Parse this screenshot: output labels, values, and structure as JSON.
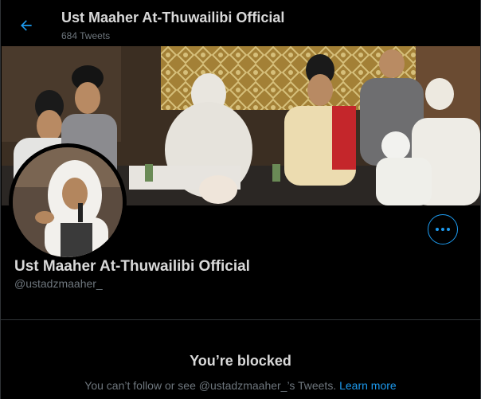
{
  "header": {
    "title": "Ust Maaher At-Thuwailibi Official",
    "tweet_count": "684 Tweets"
  },
  "profile": {
    "display_name": "Ust Maaher At-Thuwailibi Official",
    "handle": "@ustadzmaaher_"
  },
  "blocked": {
    "title": "You’re blocked",
    "message": "You can’t follow or see @ustadzmaaher_’s Tweets.",
    "link_label": "Learn more"
  },
  "colors": {
    "background": "#000000",
    "accent": "#1d9bf0",
    "primary_text": "#d9d9d9",
    "secondary_text": "#6e767d",
    "divider": "#2f3336"
  },
  "icons": {
    "back": "arrow-left-icon",
    "more": "more-horizontal-icon"
  }
}
